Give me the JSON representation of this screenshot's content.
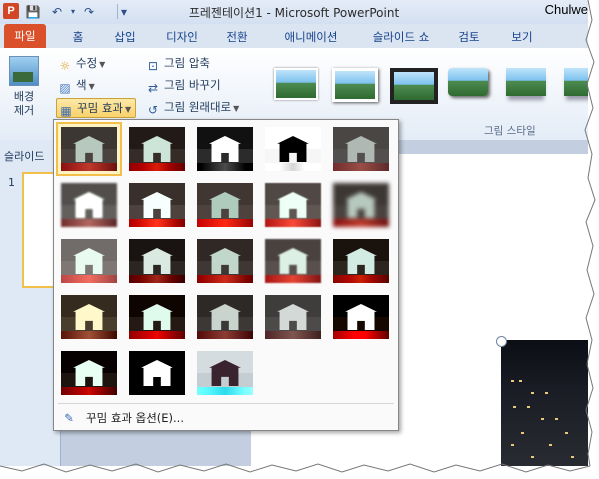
{
  "window": {
    "title": "프레젠테이션1 - Microsoft PowerPoint",
    "user": "Chulwe",
    "app_icon_letter": "P"
  },
  "qat": {
    "save": "💾",
    "undo": "↶",
    "redo": "↷",
    "customize": "▾"
  },
  "tabs": [
    "파일",
    "홈",
    "삽입",
    "디자인",
    "전환",
    "애니메이션",
    "슬라이드 쇼",
    "검토",
    "보기"
  ],
  "ribbon": {
    "remove_bg": "배경 제거",
    "corrections": "수정",
    "color": "색",
    "artistic_effects": "꾸밈 효과",
    "compress": "그림 압축",
    "change_picture": "그림 바꾸기",
    "reset_picture": "그림 원래대로",
    "picture_styles_label": "그림 스타일"
  },
  "slide_pane": {
    "tab_label": "슬라이드",
    "slide_number": "1"
  },
  "artistic_menu": {
    "options_label": "꾸밈 효과 옵션(E)...",
    "effects": [
      "none",
      "marker",
      "pencil-grayscale",
      "pencil-sketch",
      "line-drawing",
      "chalk-sketch",
      "paint-strokes",
      "paint-brush",
      "glow-diffused",
      "blur",
      "light-screen",
      "watercolor-sponge",
      "film-grain",
      "mosaic-bubbles",
      "glass",
      "cement",
      "texturizer",
      "crisscross-etching",
      "pastels-smooth",
      "plastic-wrap",
      "cutout",
      "photocopy",
      "glow-edges"
    ],
    "selected_index": 0
  },
  "colors": {
    "file_tab": "#d9502b",
    "selection": "#f2c04a",
    "ribbon_bg": "#e3ecf7"
  }
}
